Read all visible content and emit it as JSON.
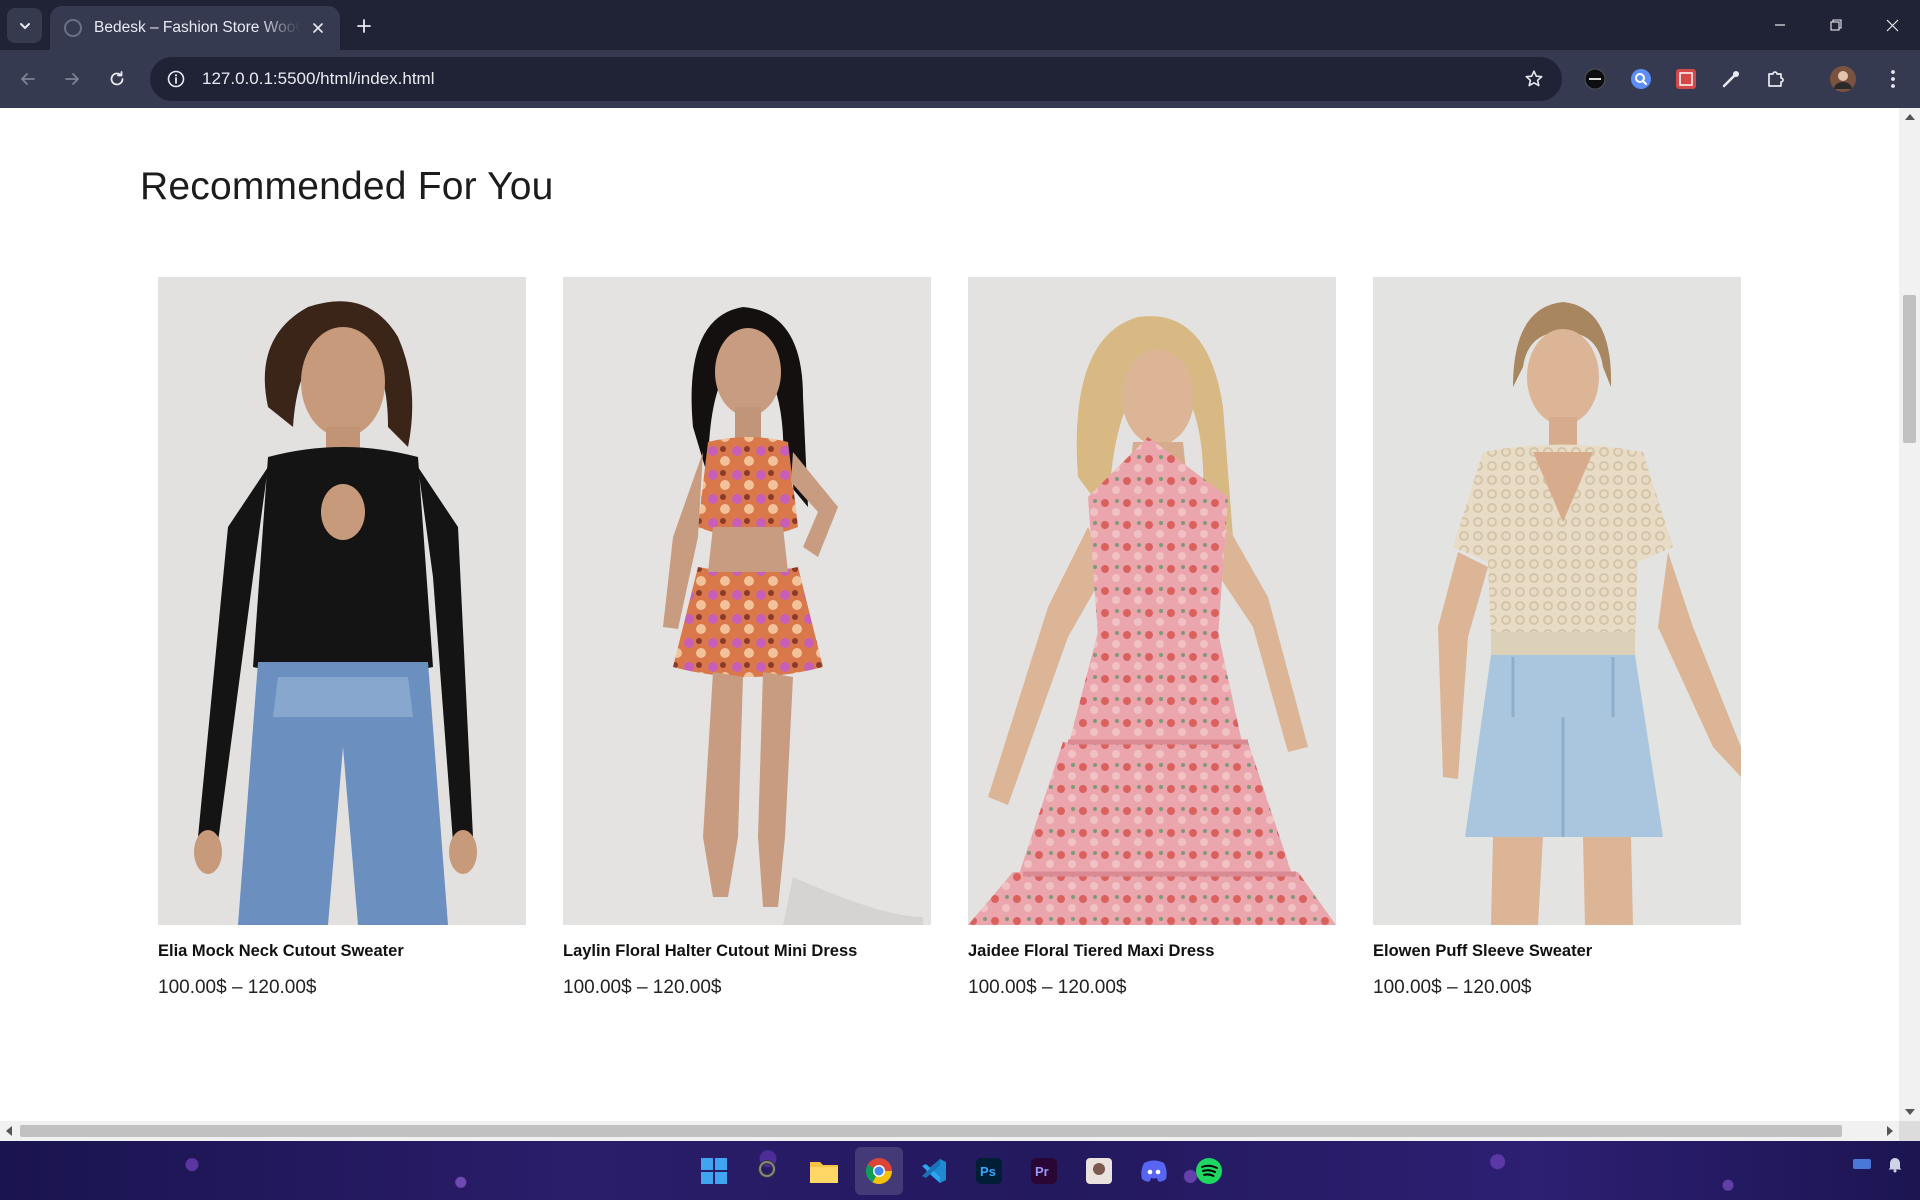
{
  "browser": {
    "tab": {
      "title": "Bedesk – Fashion Store WooCommerce"
    },
    "address_bar": {
      "url": "127.0.0.1:5500/html/index.html"
    }
  },
  "section": {
    "title": "Recommended For You"
  },
  "products": [
    {
      "name": "Elia Mock Neck Cutout Sweater",
      "price": "100.00$ – 120.00$"
    },
    {
      "name": "Laylin Floral Halter Cutout Mini Dress",
      "price": "100.00$ – 120.00$"
    },
    {
      "name": "Jaidee Floral Tiered Maxi Dress",
      "price": "100.00$ – 120.00$"
    },
    {
      "name": "Elowen Puff Sleeve Sweater",
      "price": "100.00$ – 120.00$"
    }
  ],
  "colors": {
    "chrome_dark": "#1f2335",
    "chrome_toolbar": "#353a50",
    "page_bg": "#ffffff",
    "photo_bg": "#e4e3e1"
  },
  "icons": {
    "tab_menu": "chevron-down-icon",
    "tab_close": "close-icon",
    "new_tab": "plus-icon",
    "back": "arrow-left-icon",
    "forward": "arrow-right-icon",
    "reload": "reload-icon",
    "site_info": "info-icon",
    "bookmark": "star-icon",
    "extensions": "puzzle-icon",
    "menu": "kebab-menu-icon"
  }
}
